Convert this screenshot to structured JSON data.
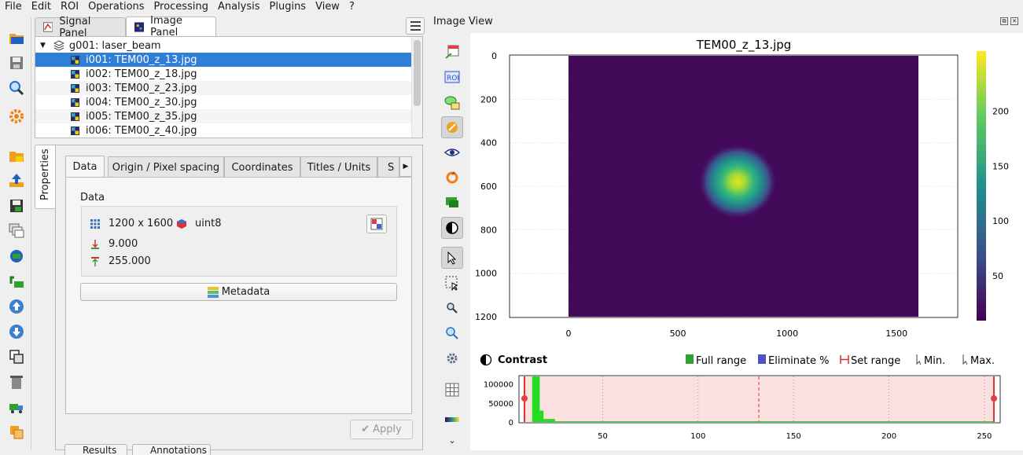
{
  "menubar": [
    "File",
    "Edit",
    "ROI",
    "Operations",
    "Processing",
    "Analysis",
    "Plugins",
    "View",
    "?"
  ],
  "panel_tabs": {
    "signal": "Signal Panel",
    "image": "Image Panel"
  },
  "tree": {
    "group": "g001: laser_beam",
    "items": [
      "i001: TEM00_z_13.jpg",
      "i002: TEM00_z_18.jpg",
      "i003: TEM00_z_23.jpg",
      "i004: TEM00_z_30.jpg",
      "i005: TEM00_z_35.jpg",
      "i006: TEM00_z_40.jpg"
    ],
    "selected_index": 0
  },
  "properties": {
    "vertical_tab": "Properties",
    "tabs": [
      "Data",
      "Origin / Pixel spacing",
      "Coordinates",
      "Titles / Units",
      "S"
    ],
    "active_tab": "Data",
    "group_title": "Data",
    "shape": "1200 x 1600",
    "dtype": "uint8",
    "min": "9.000",
    "max": "255.000",
    "metadata_button": "Metadata",
    "apply_button": "Apply",
    "bottom_buttons": [
      "Results",
      "Annotations"
    ]
  },
  "image_view": {
    "panel_title": "Image View",
    "plot_title": "TEM00_z_13.jpg",
    "x_ticks": [
      "0",
      "500",
      "1000",
      "1500"
    ],
    "y_ticks": [
      "0",
      "200",
      "400",
      "600",
      "800",
      "1000",
      "1200"
    ],
    "colorbar_ticks": [
      "50",
      "100",
      "150",
      "200"
    ],
    "contrast": {
      "label": "Contrast",
      "full_range": "Full range",
      "eliminate": "Eliminate %",
      "set_range": "Set range",
      "min": "Min.",
      "max": "Max.",
      "hist_y_ticks": [
        "0",
        "50000",
        "100000"
      ],
      "hist_x_ticks": [
        "50",
        "100",
        "150",
        "200",
        "250"
      ]
    }
  },
  "colors": {
    "selection": "#2f7ed8",
    "histogram": "#22dd22",
    "range_fill": "#fbe0e0",
    "range_marker": "#dd3333"
  },
  "chart_data": {
    "type": "heatmap",
    "title": "TEM00_z_13.jpg",
    "shape": [
      1200,
      1600
    ],
    "x_range": [
      0,
      1600
    ],
    "y_range": [
      0,
      1200
    ],
    "y_inverted": true,
    "colorbar_range": [
      9,
      255
    ],
    "colormap": "viridis",
    "blob_center": [
      780,
      570
    ],
    "histogram": {
      "x_range": [
        9,
        255
      ],
      "y_range": [
        0,
        120000
      ],
      "peak_x": [
        13,
        17
      ],
      "range_min": 9,
      "range_max": 255,
      "range_mid_marker": 130
    }
  }
}
